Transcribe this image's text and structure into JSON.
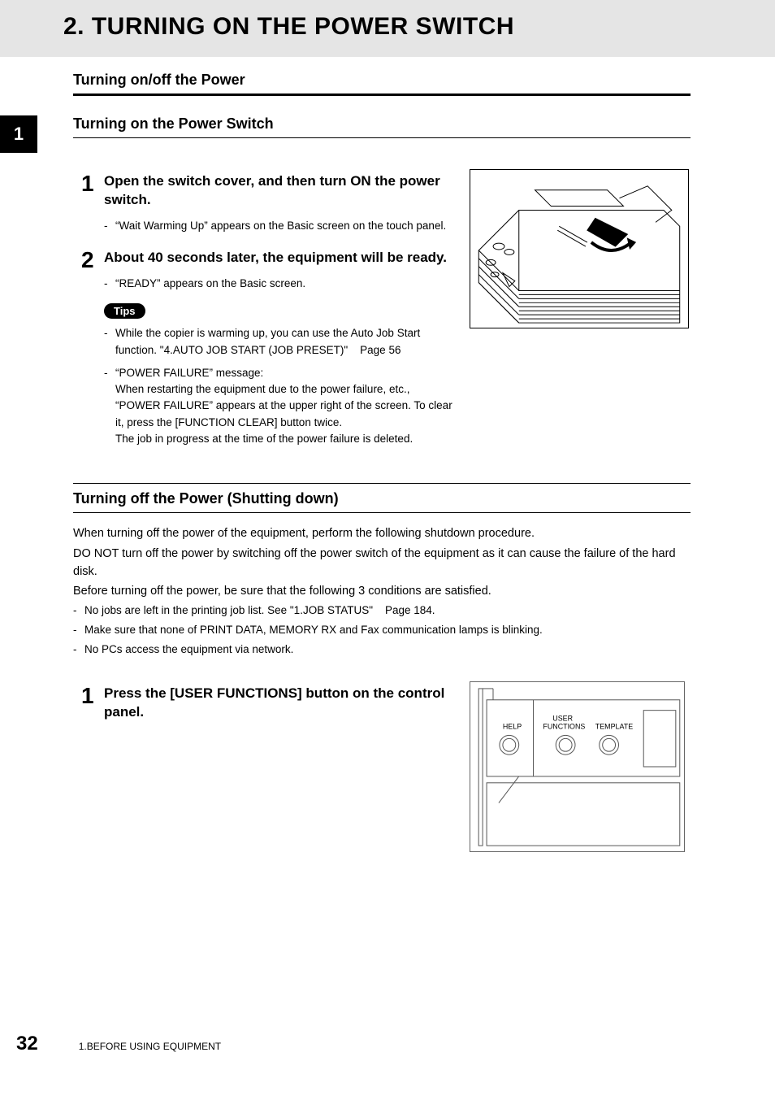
{
  "header": {
    "title": "2. TURNING ON THE POWER SWITCH"
  },
  "section1": {
    "heading": "Turning on/off the Power",
    "chapter_tab": "1",
    "sub_heading": "Turning on the Power Switch",
    "steps": [
      {
        "num": "1",
        "title": "Open the switch cover, and then turn ON the power switch.",
        "bullets": [
          "“Wait Warming Up” appears on the Basic screen on the touch panel."
        ]
      },
      {
        "num": "2",
        "title": "About 40 seconds later, the equipment will be ready.",
        "bullets": [
          "“READY” appears on the Basic screen."
        ]
      }
    ],
    "tips_label": "Tips",
    "tips_bullets": [
      "While the copier is warming up, you can use the Auto Job Start function. \"4.AUTO JOB START (JOB PRESET)\"    Page 56",
      "“POWER FAILURE” message:\nWhen restarting the equipment due to the power failure, etc., “POWER FAILURE” appears at the upper right of the screen. To clear it, press the [FUNCTION CLEAR] button twice.\nThe job in progress at the time of the power failure is deleted."
    ]
  },
  "section2": {
    "sub_heading": "Turning off the Power (Shutting down)",
    "paras": [
      "When turning off the power of the equipment, perform the following shutdown procedure.",
      "DO NOT turn off the power by switching off the power switch of the equipment as it can cause the failure of the hard disk.",
      "Before turning off the power, be sure that the following 3 conditions are satisfied."
    ],
    "bullets": [
      "No jobs are left in the printing job list. See \"1.JOB STATUS\"    Page 184.",
      "Make sure that none of PRINT DATA, MEMORY RX and Fax communication lamps is blinking.",
      "No PCs access the equipment via network."
    ],
    "steps": [
      {
        "num": "1",
        "title": "Press the [USER FUNCTIONS] button on the control panel."
      }
    ],
    "panel_labels": {
      "help": "HELP",
      "user_functions": "USER\nFUNCTIONS",
      "template": "TEMPLATE"
    }
  },
  "footer": {
    "page_number": "32",
    "text": "1.BEFORE USING EQUIPMENT"
  }
}
